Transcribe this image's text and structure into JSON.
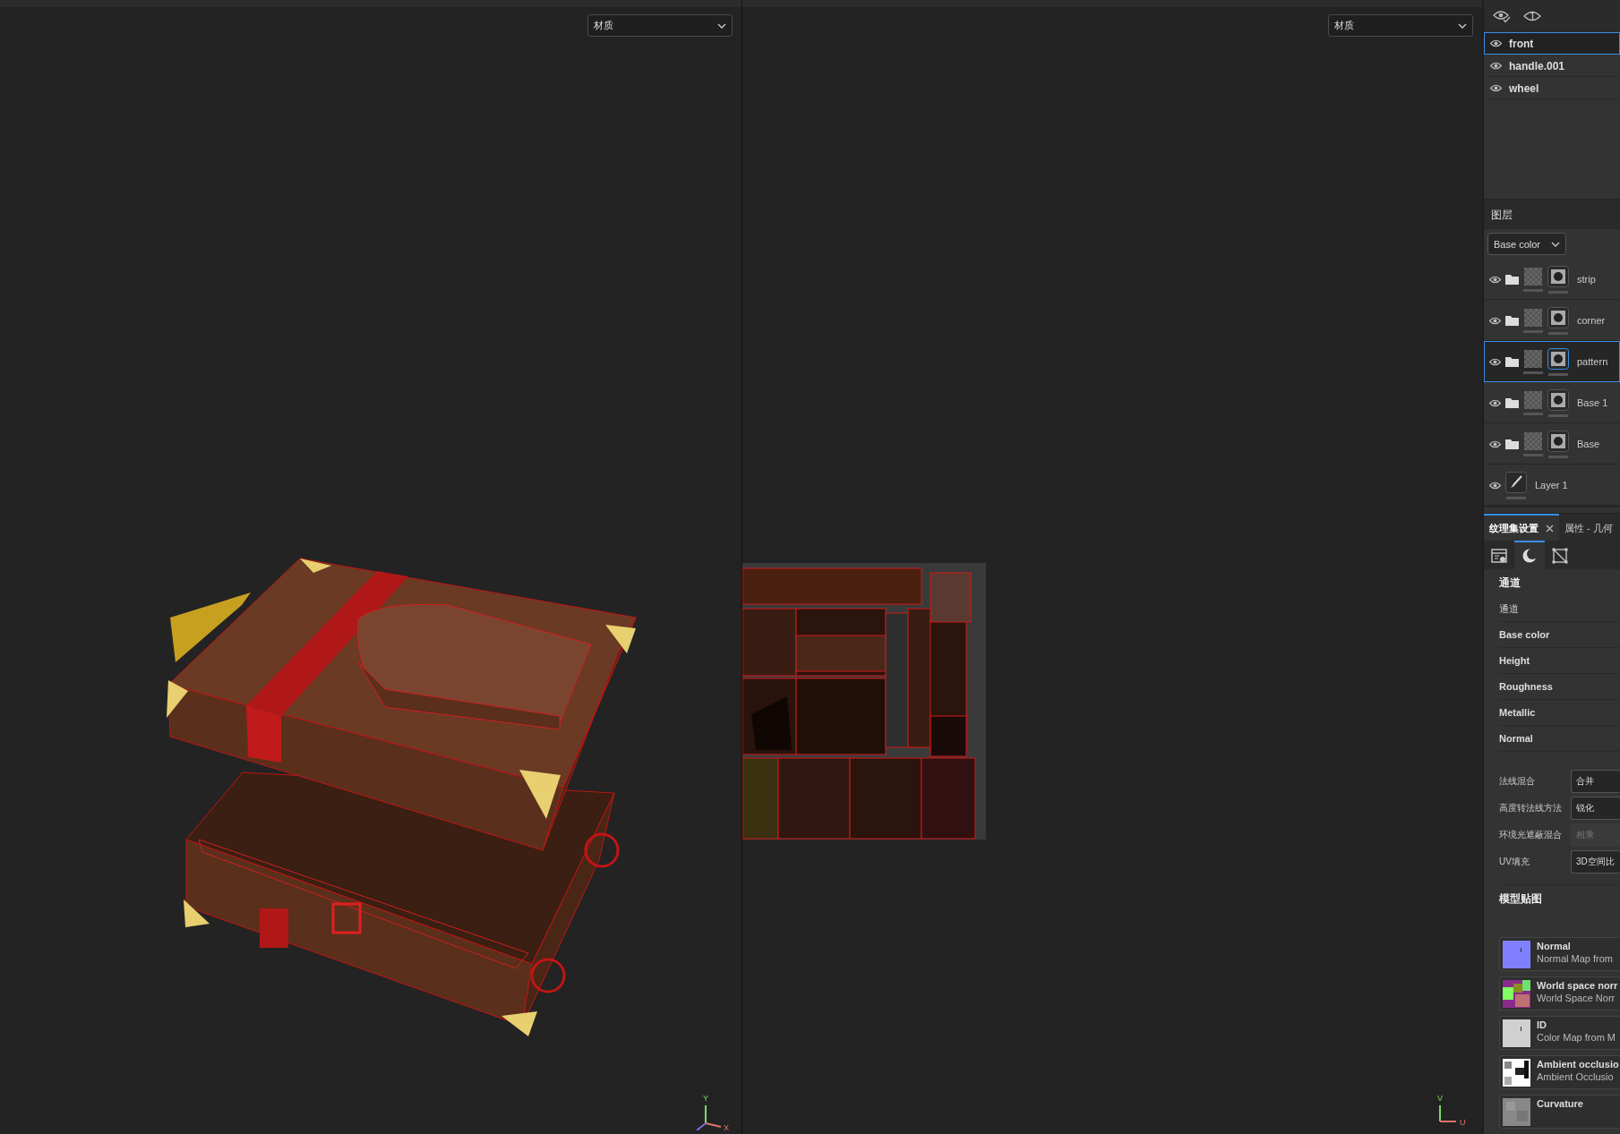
{
  "viewports": [
    {
      "kind": "model",
      "dropdown": "材质",
      "axes": [
        {
          "kind": "y",
          "label": "Y"
        },
        {
          "kind": "x",
          "label": "X"
        }
      ]
    },
    {
      "kind": "uv",
      "dropdown": "材质",
      "axes": [
        {
          "kind": "y",
          "label": "V"
        },
        {
          "kind": "x",
          "label": "U"
        }
      ]
    }
  ],
  "objects": [
    {
      "name": "front",
      "selected": true
    },
    {
      "name": "handle.001",
      "selected": false
    },
    {
      "name": "wheel",
      "selected": false
    }
  ],
  "layers_panel": {
    "title": "图层",
    "channel": "Base color",
    "layers": [
      {
        "kind": "folder",
        "name": "strip",
        "selected": false
      },
      {
        "kind": "folder",
        "name": "corner",
        "selected": false
      },
      {
        "kind": "folder",
        "name": "pattern",
        "selected": true
      },
      {
        "kind": "folder",
        "name": "Base 1",
        "selected": false
      },
      {
        "kind": "folder",
        "name": "Base",
        "selected": false
      },
      {
        "kind": "paint",
        "name": "Layer 1",
        "selected": false
      }
    ]
  },
  "tabs": [
    {
      "label": "纹理集设置",
      "selected": true,
      "closable": true
    },
    {
      "label": "属性 - 几何",
      "selected": false,
      "closable": false
    }
  ],
  "icon_tabs": [
    {
      "kind": "settings",
      "selected": false
    },
    {
      "kind": "material",
      "selected": true
    },
    {
      "kind": "uv",
      "selected": false
    }
  ],
  "channels": {
    "title": "通道",
    "label": "通道",
    "items": [
      "Base color",
      "Height",
      "Roughness",
      "Metallic",
      "Normal"
    ]
  },
  "settings": [
    {
      "label": "法线混合",
      "value": "合并",
      "disabled": false
    },
    {
      "label": "高度转法线方法",
      "value": "锐化",
      "disabled": false
    },
    {
      "label": "环境光遮蔽混合",
      "value": "相乘",
      "disabled": true
    },
    {
      "label": "UV填充",
      "value": "3D空间比",
      "disabled": false
    }
  ],
  "model_maps": {
    "title": "模型贴图",
    "items": [
      {
        "kind": "normal",
        "name": "Normal",
        "description": "Normal Map from"
      },
      {
        "kind": "world",
        "name": "World space norr",
        "description": "World Space Norr"
      },
      {
        "kind": "id",
        "name": "ID",
        "description": "Color Map from M"
      },
      {
        "kind": "ao",
        "name": "Ambient occlusio",
        "description": "Ambient Occlusio"
      },
      {
        "kind": "curvature",
        "name": "Curvature"
      }
    ]
  }
}
